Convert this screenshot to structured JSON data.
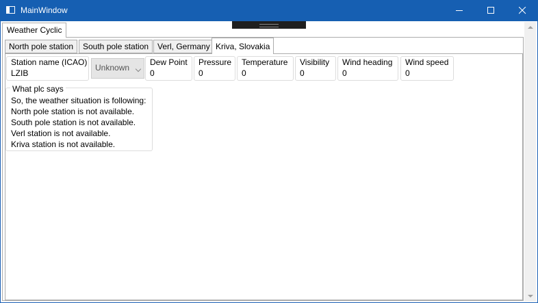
{
  "window": {
    "title": "MainWindow"
  },
  "outer_tab": "Weather Cyclic",
  "tabs": [
    "North pole station",
    "South pole station",
    "Verl, Germany",
    "Kriva, Slovakia"
  ],
  "station": {
    "label": "Station name (ICAO)",
    "value": "LZIB"
  },
  "combo": {
    "value": "Unknown"
  },
  "fields": [
    {
      "label": "Dew Point",
      "value": "0"
    },
    {
      "label": "Pressure",
      "value": "0"
    },
    {
      "label": "Temperature",
      "value": "0"
    },
    {
      "label": "Visibility",
      "value": "0"
    },
    {
      "label": "Wind heading",
      "value": "0"
    },
    {
      "label": "Wind speed",
      "value": "0"
    }
  ],
  "plc": {
    "legend": "What plc says",
    "lines": [
      "So, the weather situation is following:",
      "North pole station is not available.",
      "South pole station is not available.",
      "Verl station is not available.",
      "Kriva station is not available."
    ]
  },
  "colors": {
    "titlebar": "#165fb2",
    "border": "#acacac"
  }
}
